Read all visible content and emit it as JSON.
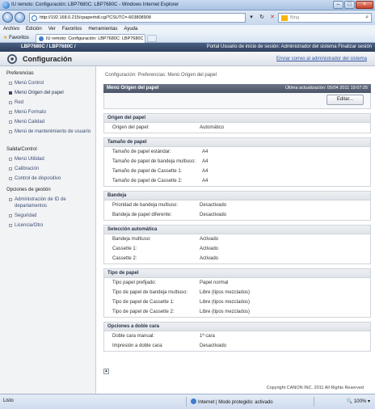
{
  "window": {
    "title": "IU remoto: Configuración: LBP7680C: LBP7680C - Windows Internet Explorer"
  },
  "addressbar": {
    "url": "http://192.168.0.215/cpaperhdl.cgi?CSUTC=-603808908",
    "search_placeholder": "Bing"
  },
  "menubar": [
    "Archivo",
    "Edición",
    "Ver",
    "Favoritos",
    "Herramientas",
    "Ayuda"
  ],
  "favbar": {
    "favorites_label": "Favoritos",
    "tab_label": "IU remoto: Configuración: LBP7680C: LBP7680C"
  },
  "devbar": {
    "model": "LBP7680C / LBP7680C /",
    "portal": "Portal   Usuario de inicio de sesión: Administrador del sistema Finalizar sesión"
  },
  "header": {
    "title": "Configuración",
    "mail_link": "Enviar correo al administrador del sistema"
  },
  "sidebar": {
    "preferences_title": "Preferencias",
    "preferences": [
      "Menú Control",
      "Menú Origen del papel",
      "Red",
      "Menú Formato",
      "Menú Calidad",
      "Menú de mantenimiento de usuario"
    ],
    "output_title": "Salida/Control",
    "output": [
      "Menú Utilidad",
      "Calibración",
      "Control de dispositivo"
    ],
    "management_title": "Opciones de gestión",
    "management": [
      "Administración de ID de departamentos",
      "Seguridad",
      "Licencia/Otro"
    ]
  },
  "content": {
    "breadcrumb": "Configuración: Preferencias: Menú Origen del papel",
    "panel_title": "Menú Origen del papel",
    "updated": "Última actualización: 05/04 2011 19:07:25",
    "edit_button": "Editar...",
    "sections": [
      {
        "title": "Origen del papel",
        "rows": [
          {
            "label": "Origen del papel:",
            "value": "Automático"
          }
        ]
      },
      {
        "title": "Tamaño de papel",
        "rows": [
          {
            "label": "Tamaño de papel estándar:",
            "value": "A4"
          },
          {
            "label": "Tamaño de papel de bandeja multiuso:",
            "value": "A4"
          },
          {
            "label": "Tamaño de papel de Cassette 1:",
            "value": "A4"
          },
          {
            "label": "Tamaño de papel de Cassette 2:",
            "value": "A4"
          }
        ]
      },
      {
        "title": "Bandeja",
        "rows": [
          {
            "label": "Prioridad de bandeja multiuso:",
            "value": "Desactivado"
          },
          {
            "label": "Bandeja de papel diferente:",
            "value": "Desactivado"
          }
        ]
      },
      {
        "title": "Selección automática",
        "rows": [
          {
            "label": "Bandeja multiuso:",
            "value": "Activado"
          },
          {
            "label": "Cassette 1:",
            "value": "Activado"
          },
          {
            "label": "Cassette 2:",
            "value": "Activado"
          }
        ]
      },
      {
        "title": "Tipo de papel",
        "rows": [
          {
            "label": "Tipo papel prefijado:",
            "value": "Papel normal"
          },
          {
            "label": "Tipo de papel de bandeja multiuso:",
            "value": "Libre (tipos mezclados)"
          },
          {
            "label": "Tipo de papel de Cassette 1:",
            "value": "Libre (tipos mezclados)"
          },
          {
            "label": "Tipo de papel de Cassette 2:",
            "value": "Libre (tipos mezclados)"
          }
        ]
      },
      {
        "title": "Opciones a doble cara",
        "rows": [
          {
            "label": "Doble cara manual:",
            "value": "1ª cara"
          },
          {
            "label": "Impresión a doble cara:",
            "value": "Desactivado"
          }
        ]
      }
    ],
    "copyright": "Copyright CANON INC. 2011 All Rights Reserved"
  },
  "statusbar": {
    "status": "Listo",
    "zone": "Internet | Modo protegido: activado",
    "zoom": "100%"
  }
}
